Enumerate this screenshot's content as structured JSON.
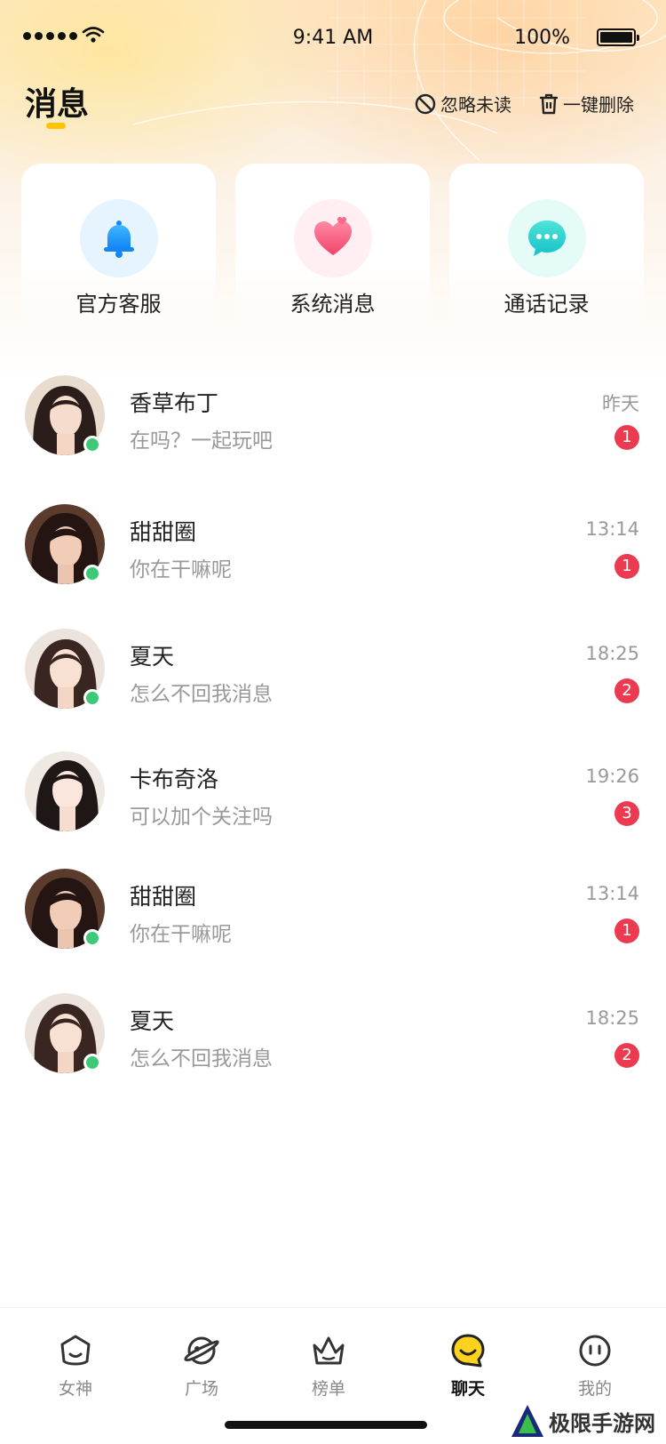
{
  "status_bar": {
    "time": "9:41 AM",
    "battery": "100%"
  },
  "header": {
    "title": "消息",
    "ignore_unread": "忽略未读",
    "delete_all": "一键删除"
  },
  "quick_entries": [
    {
      "label": "官方客服",
      "icon": "bell-icon"
    },
    {
      "label": "系统消息",
      "icon": "heart-icon"
    },
    {
      "label": "通话记录",
      "icon": "chat-bubble-icon"
    }
  ],
  "conversations": [
    {
      "name": "香草布丁",
      "preview": "在吗？一起玩吧",
      "time": "昨天",
      "unread": "1",
      "online": true
    },
    {
      "name": "甜甜圈",
      "preview": "你在干嘛呢",
      "time": "13:14",
      "unread": "1",
      "online": true
    },
    {
      "name": "夏天",
      "preview": "怎么不回我消息",
      "time": "18:25",
      "unread": "2",
      "online": true
    },
    {
      "name": "卡布奇洛",
      "preview": "可以加个关注吗",
      "time": "19:26",
      "unread": "3",
      "online": false
    },
    {
      "name": "甜甜圈",
      "preview": "你在干嘛呢",
      "time": "13:14",
      "unread": "1",
      "online": true
    },
    {
      "name": "夏天",
      "preview": "怎么不回我消息",
      "time": "18:25",
      "unread": "2",
      "online": true
    }
  ],
  "tabs": [
    {
      "label": "女神",
      "icon": "goddess-icon",
      "active": false
    },
    {
      "label": "广场",
      "icon": "planet-icon",
      "active": false
    },
    {
      "label": "榜单",
      "icon": "crown-icon",
      "active": false
    },
    {
      "label": "聊天",
      "icon": "smile-chat-icon",
      "active": true
    },
    {
      "label": "我的",
      "icon": "profile-face-icon",
      "active": false
    }
  ],
  "watermark": "极限手游网",
  "colors": {
    "accent": "#ffc400",
    "badge": "#ec3a50",
    "online": "#3ec978"
  }
}
